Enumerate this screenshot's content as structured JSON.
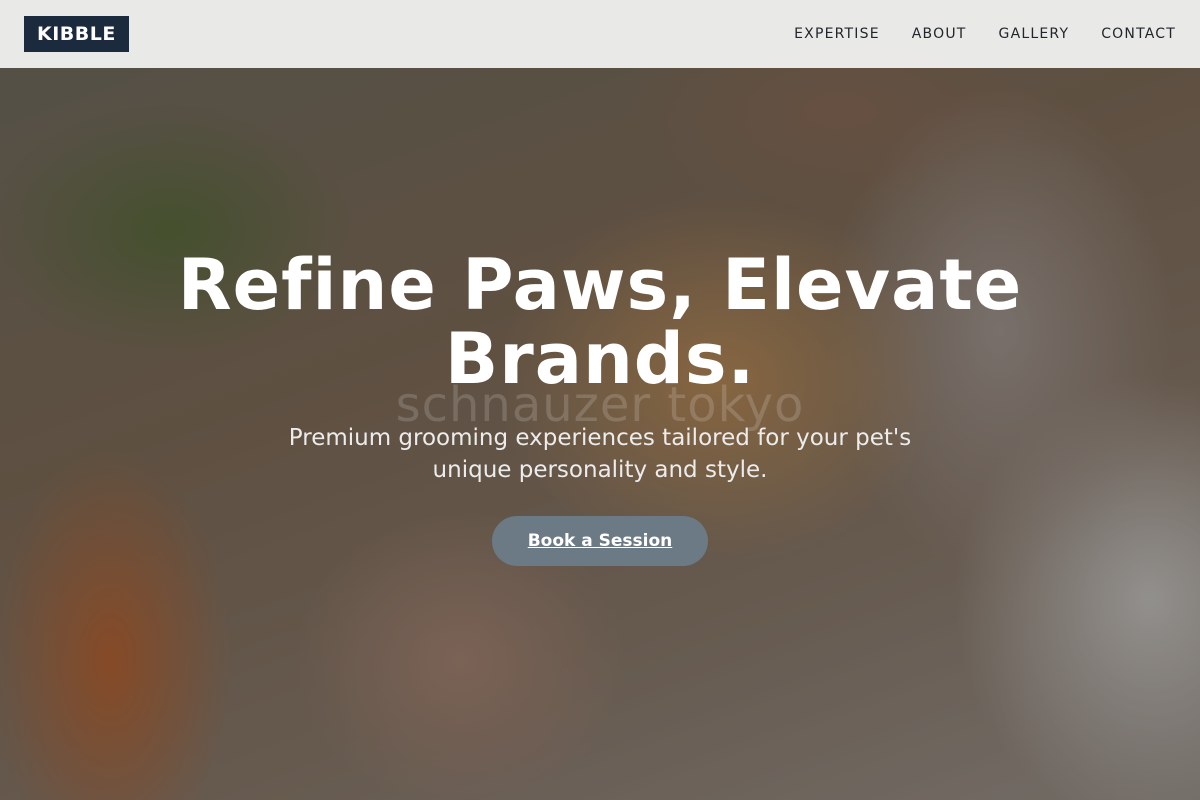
{
  "header": {
    "logo": "KIBBLE",
    "nav": [
      {
        "label": "EXPERTISE"
      },
      {
        "label": "ABOUT"
      },
      {
        "label": "GALLERY"
      },
      {
        "label": "CONTACT"
      }
    ]
  },
  "hero": {
    "title": "Refine Paws, Elevate Brands.",
    "subtitle": "Premium grooming experiences tailored for your pet's unique personality and style.",
    "cta_label": "Book a Session",
    "watermark": "schnauzer tokyo"
  },
  "colors": {
    "logo_bg": "#1c2a3d",
    "cta_bg": "#6c7a85",
    "header_bg": "#f2f2f2"
  }
}
